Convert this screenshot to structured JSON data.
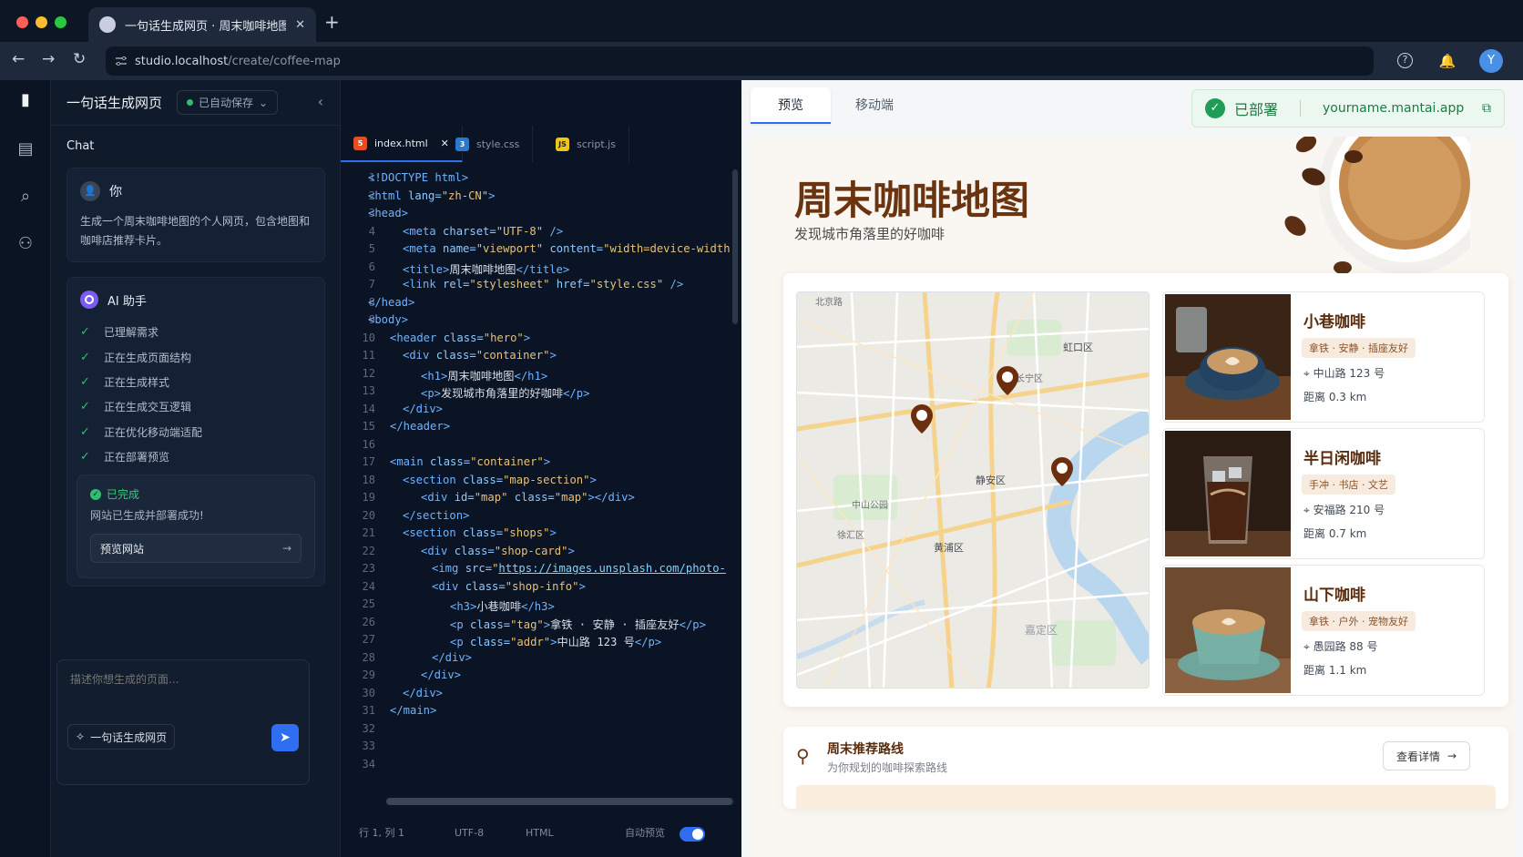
{
  "browser": {
    "tab_title": "一句话生成网页 · 周末咖啡地图",
    "url_host": "studio.localhost",
    "url_path": "/create/coffee-map",
    "avatar_initial": "Y"
  },
  "chat_panel": {
    "app_name": "一句话生成网页",
    "autosave_label": "已自动保存",
    "section_label": "Chat",
    "user": {
      "name": "你",
      "message": "生成一个周末咖啡地图的个人网页，包含地图和咖啡店推荐卡片。"
    },
    "assistant": {
      "name": "AI 助手",
      "steps": [
        "已理解需求",
        "正在生成页面结构",
        "正在生成样式",
        "正在生成交互逻辑",
        "正在优化移动端适配",
        "正在部署预览"
      ],
      "done_title": "已完成",
      "done_message": "网站已生成并部署成功!",
      "preview_button": "预览网站"
    },
    "input_placeholder": "描述你想生成的页面...",
    "mode_chip": "一句话生成网页"
  },
  "editor": {
    "tabs": [
      {
        "name": "index.html",
        "icon": "html5-icon"
      },
      {
        "name": "style.css",
        "icon": "css3-icon"
      },
      {
        "name": "script.js",
        "icon": "js-icon"
      }
    ],
    "line_numbers": [
      "1",
      "2",
      "3",
      "4",
      "5",
      "6",
      "7",
      "8",
      "9",
      "10",
      "11",
      "12",
      "13",
      "14",
      "15",
      "16",
      "17",
      "18",
      "19",
      "20",
      "21",
      "22",
      "23",
      "24",
      "25",
      "26",
      "27",
      "28",
      "29",
      "30",
      "31",
      "32",
      "33",
      "34"
    ],
    "status": {
      "position": "行 1, 列 1",
      "encoding": "UTF-8",
      "language": "HTML",
      "auto_preview": "自动预览"
    }
  },
  "preview": {
    "tabs": [
      "预览",
      "移动端"
    ],
    "deploy_status": "已部署",
    "deploy_domain": "yourname.mantai.app",
    "site": {
      "title": "周末咖啡地图",
      "subtitle": "发现城市角落里的好咖啡",
      "map_labels": [
        "北京路",
        "中山公园",
        "静安区",
        "黄浦区",
        "虹口区",
        "嘉定区",
        "徐汇区",
        "长宁区"
      ],
      "shops": [
        {
          "name": "小巷咖啡",
          "tag": "拿铁 · 安静 · 插座友好",
          "address": "中山路 123 号",
          "distance": "距离 0.3 km"
        },
        {
          "name": "半日闲咖啡",
          "tag": "手冲 · 书店 · 文艺",
          "address": "安福路 210 号",
          "distance": "距离 0.7 km"
        },
        {
          "name": "山下咖啡",
          "tag": "拿铁 · 户外 · 宠物友好",
          "address": "愚园路 88 号",
          "distance": "距离 1.1 km"
        }
      ],
      "route": {
        "title": "周末推荐路线",
        "subtitle": "为你规划的咖啡探索路线",
        "button": "查看详情"
      }
    }
  },
  "colors": {
    "accent": "#2f6ef0",
    "success": "#2fbf71",
    "coffee": "#6b3410"
  }
}
